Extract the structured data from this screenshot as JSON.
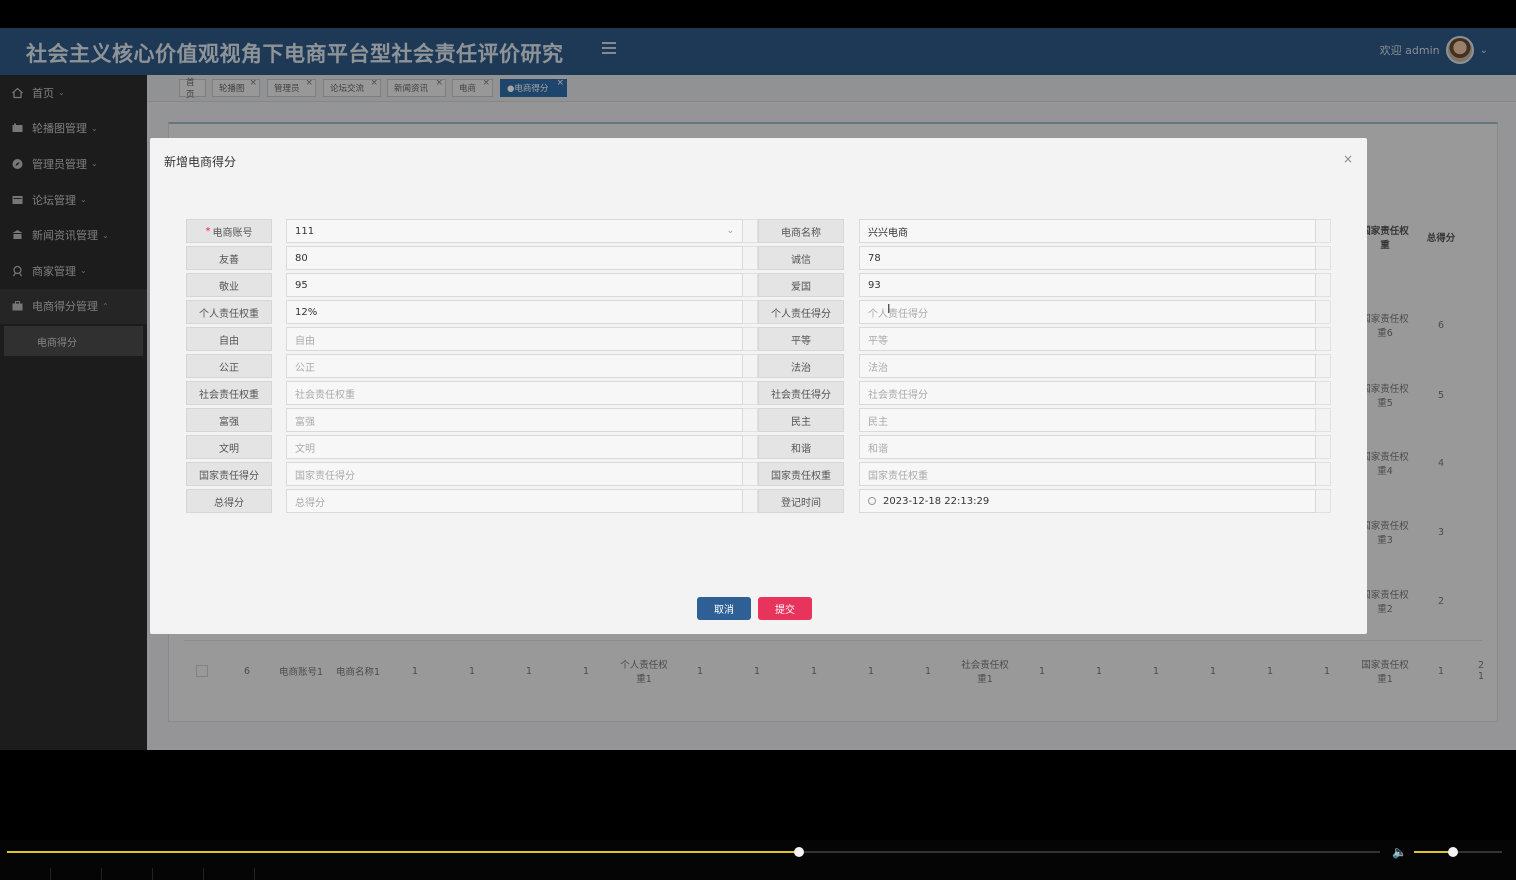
{
  "app": {
    "title": "社会主义核心价值观视角下电商平台型社会责任评价研究",
    "welcome": "欢迎 admin"
  },
  "sidebar": {
    "items": [
      {
        "label": "首页"
      },
      {
        "label": "轮播图管理"
      },
      {
        "label": "管理员管理"
      },
      {
        "label": "论坛管理"
      },
      {
        "label": "新闻资讯管理"
      },
      {
        "label": "商家管理"
      },
      {
        "label": "电商得分管理"
      }
    ],
    "sub_item": "电商得分"
  },
  "tabs": [
    {
      "label": "首页"
    },
    {
      "label": "轮播图"
    },
    {
      "label": "管理员"
    },
    {
      "label": "论坛交流"
    },
    {
      "label": "新闻资讯"
    },
    {
      "label": "电商"
    },
    {
      "label": "●电商得分"
    }
  ],
  "background_table": {
    "headers": {
      "col_weight": "国家责任权重",
      "col_total": "总得分"
    },
    "weights": [
      "国家责任权重6",
      "国家责任权重5",
      "国家责任权重4",
      "国家责任权重3",
      "国家责任权重2"
    ],
    "totals": [
      "6",
      "5",
      "4",
      "3",
      "2"
    ],
    "last_row": {
      "index": "6",
      "account": "电商账号1",
      "name": "电商名称1",
      "one": "1",
      "personal_weight": "个人责任权重1",
      "social_weight": "社会责任权重1",
      "national_weight": "国家责任权重1",
      "total": "1"
    },
    "edge_values": [
      "2",
      "1"
    ]
  },
  "dialog": {
    "title": "新增电商得分",
    "close": "×",
    "cancel_label": "取消",
    "submit_label": "提交",
    "left_fields": [
      {
        "label": "电商账号",
        "value": "111",
        "required": "*"
      },
      {
        "label": "友善",
        "value": "80"
      },
      {
        "label": "敬业",
        "value": "95"
      },
      {
        "label": "个人责任权重",
        "value": "12%"
      },
      {
        "label": "自由",
        "placeholder": "自由"
      },
      {
        "label": "公正",
        "placeholder": "公正"
      },
      {
        "label": "社会责任权重",
        "placeholder": "社会责任权重"
      },
      {
        "label": "富强",
        "placeholder": "富强"
      },
      {
        "label": "文明",
        "placeholder": "文明"
      },
      {
        "label": "国家责任得分",
        "placeholder": "国家责任得分"
      },
      {
        "label": "总得分",
        "placeholder": "总得分"
      }
    ],
    "right_fields": [
      {
        "label": "电商名称",
        "value": "兴兴电商"
      },
      {
        "label": "诚信",
        "value": "78"
      },
      {
        "label": "爱国",
        "value": "93"
      },
      {
        "label": "个人责任得分",
        "placeholder": "个人责任得分"
      },
      {
        "label": "平等",
        "placeholder": "平等"
      },
      {
        "label": "法治",
        "placeholder": "法治"
      },
      {
        "label": "社会责任得分",
        "placeholder": "社会责任得分"
      },
      {
        "label": "民主",
        "placeholder": "民主"
      },
      {
        "label": "和谐",
        "placeholder": "和谐"
      },
      {
        "label": "国家责任权重",
        "placeholder": "国家责任权重"
      },
      {
        "label": "登记时间",
        "value": "2023-12-18 22:13:29"
      }
    ]
  },
  "player": {
    "progress_fraction": 0.577,
    "volume_fraction": 0.44
  },
  "colors": {
    "header": "#2f5a86",
    "sidebar": "#2c2c2c",
    "cancel_button": "#2e5f95",
    "submit_button": "#e8345c",
    "progress": "#e0c52a"
  }
}
